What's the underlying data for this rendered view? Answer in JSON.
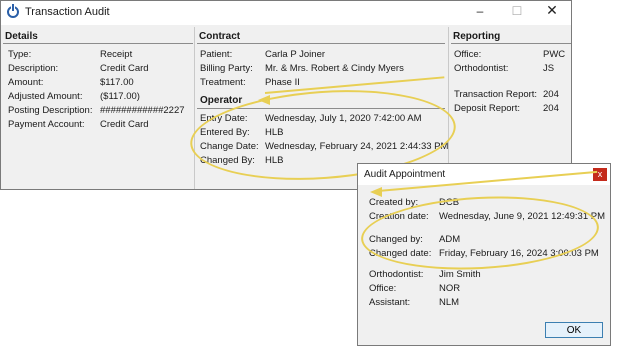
{
  "main_window": {
    "title": "Transaction Audit",
    "controls": {
      "minimize": "–",
      "maximize": "☐",
      "close": "✕"
    }
  },
  "details": {
    "heading": "Details",
    "rows": [
      {
        "label": "Type:",
        "value": "Receipt"
      },
      {
        "label": "Description:",
        "value": "Credit Card"
      },
      {
        "label": "Amount:",
        "value": "$117.00"
      },
      {
        "label": "Adjusted Amount:",
        "value": "($117.00)"
      },
      {
        "label": "Posting Description:",
        "value": "############2227"
      },
      {
        "label": "Payment Account:",
        "value": "Credit Card"
      }
    ]
  },
  "contract": {
    "heading": "Contract",
    "rows": [
      {
        "label": "Patient:",
        "value": "Carla P Joiner"
      },
      {
        "label": "Billing Party:",
        "value": "Mr. & Mrs. Robert & Cindy Myers"
      },
      {
        "label": "Treatment:",
        "value": "Phase II"
      }
    ]
  },
  "operator": {
    "heading": "Operator",
    "rows": [
      {
        "label": "Entry Date:",
        "value": "Wednesday, July 1, 2020 7:42:00 AM"
      },
      {
        "label": "Entered By:",
        "value": "HLB"
      },
      {
        "label": "Change Date:",
        "value": "Wednesday, February 24, 2021 2:44:33 PM"
      },
      {
        "label": "Changed By:",
        "value": "HLB"
      }
    ]
  },
  "reporting": {
    "heading": "Reporting",
    "rows": [
      {
        "label": "Office:",
        "value": "PWC"
      },
      {
        "label": "Orthodontist:",
        "value": "JS"
      },
      {
        "label": "Transaction Report:",
        "value": "204"
      },
      {
        "label": "Deposit Report:",
        "value": "204"
      }
    ]
  },
  "audit_dialog": {
    "title": "Audit Appointment",
    "close": "x",
    "rows": [
      {
        "label": "Created by:",
        "value": "DCB"
      },
      {
        "label": "Creation date:",
        "value": "Wednesday, June 9, 2021 12:49:31 PM"
      },
      {
        "label": "Changed by:",
        "value": "ADM"
      },
      {
        "label": "Changed date:",
        "value": "Friday, February 16, 2024 3:00:03 PM"
      },
      {
        "label": "Orthodontist:",
        "value": "Jim Smith"
      },
      {
        "label": "Office:",
        "value": "NOR"
      },
      {
        "label": "Assistant:",
        "value": "NLM"
      }
    ],
    "ok_label": "OK"
  },
  "colors": {
    "highlight": "#e8cf54",
    "dialog_close": "#c42b1c",
    "ok_border": "#3c7fb1"
  }
}
